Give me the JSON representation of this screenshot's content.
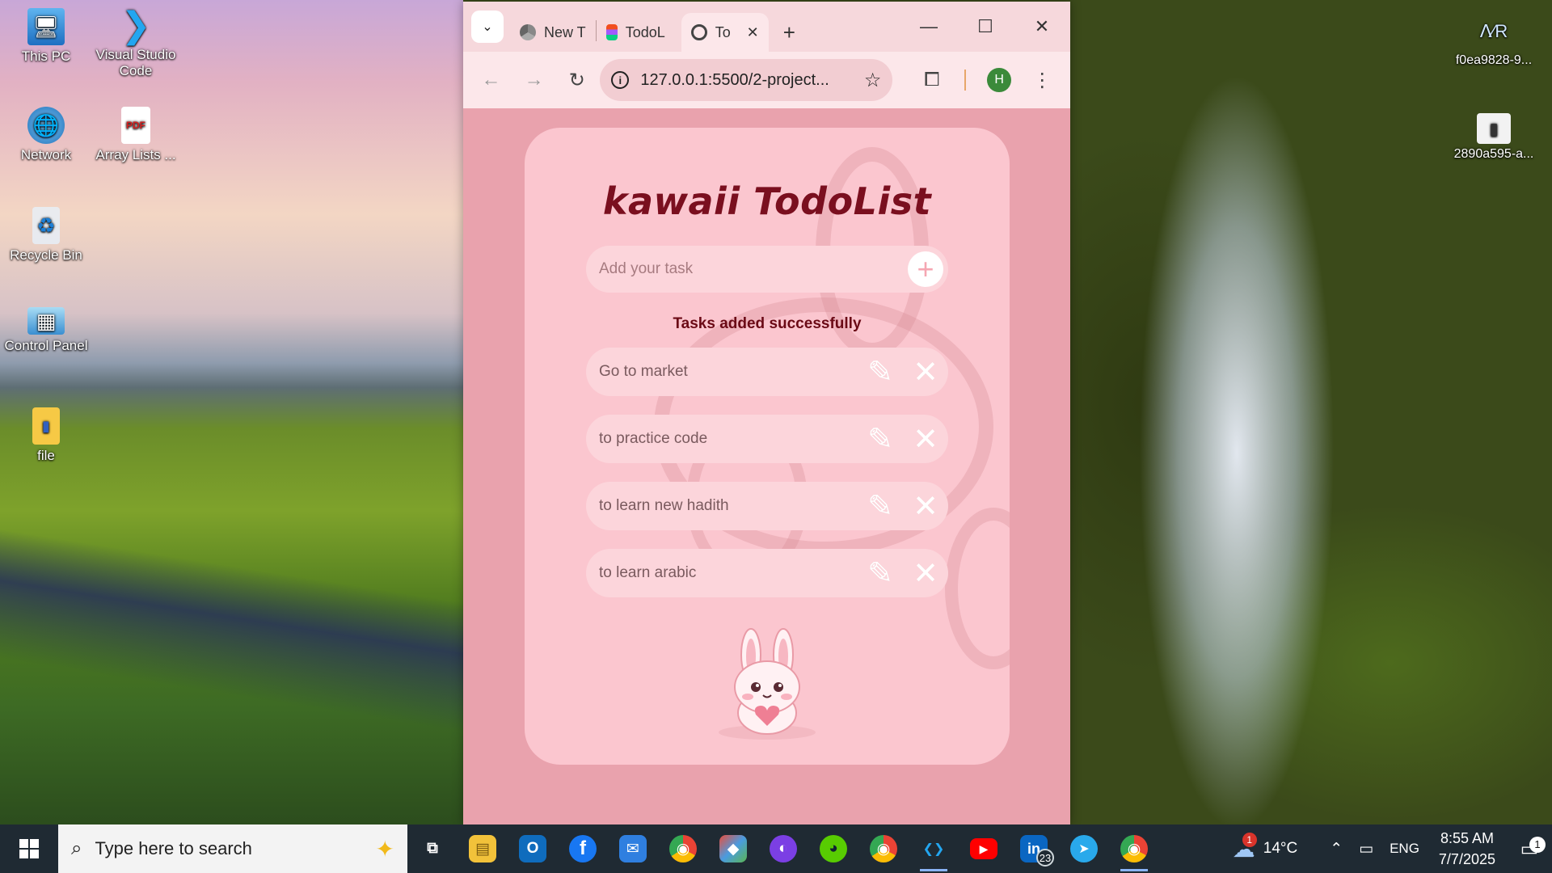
{
  "desktop": {
    "icons_left": [
      {
        "label": "This PC",
        "icon": "computer-icon"
      },
      {
        "label": "Visual Studio Code",
        "icon": "vscode-icon"
      },
      {
        "label": "Network",
        "icon": "network-icon"
      },
      {
        "label": "Array Lists ...",
        "icon": "pdf-icon"
      },
      {
        "label": "Recycle Bin",
        "icon": "recycle-bin-icon"
      },
      {
        "label": "Control Panel",
        "icon": "control-panel-icon"
      },
      {
        "label": "file",
        "icon": "file-icon"
      }
    ],
    "icons_right": [
      {
        "label": "f0ea9828-9...",
        "icon": "image-file-icon"
      },
      {
        "label": "2890a595-a...",
        "icon": "image-file-icon"
      }
    ]
  },
  "browser": {
    "tabs": [
      {
        "label": "New T",
        "icon": "chrome-icon",
        "active": false
      },
      {
        "label": "TodoL",
        "icon": "figma-icon",
        "active": false
      },
      {
        "label": "To",
        "icon": "globe-icon",
        "active": true
      }
    ],
    "new_tab": "+",
    "window_controls": {
      "minimize": "—",
      "maximize": "☐",
      "close": "✕"
    },
    "url": "127.0.0.1:5500/2-project...",
    "profile_initial": "H"
  },
  "app": {
    "title": "kawaii TodoList",
    "input_placeholder": "Add your task",
    "add_button": "+",
    "status": "Tasks added successfully",
    "tasks": [
      {
        "text": "Go to market"
      },
      {
        "text": "to practice code"
      },
      {
        "text": "to learn new hadith"
      },
      {
        "text": "to learn arabic"
      }
    ],
    "edit_icon": "✎",
    "delete_icon": "✕",
    "colors": {
      "card": "#fbc6cf",
      "page": "#e9a2ad",
      "title": "#7a0f1f"
    }
  },
  "taskbar": {
    "search_placeholder": "Type here to search",
    "apps": [
      {
        "icon": "task-view-icon",
        "glyph": "⧉"
      },
      {
        "icon": "file-explorer-icon",
        "glyph": "▤"
      },
      {
        "icon": "outlook-icon",
        "glyph": "O"
      },
      {
        "icon": "facebook-icon",
        "glyph": "f"
      },
      {
        "icon": "mail-icon",
        "glyph": "✉"
      },
      {
        "icon": "chrome-profile-icon",
        "glyph": "◉"
      },
      {
        "icon": "git-icon",
        "glyph": "◆"
      },
      {
        "icon": "github-icon",
        "glyph": "◐"
      },
      {
        "icon": "duolingo-icon",
        "glyph": "◕"
      },
      {
        "icon": "chrome-profile-icon",
        "glyph": "◉"
      },
      {
        "icon": "vscode-icon",
        "glyph": "❮❯"
      },
      {
        "icon": "youtube-icon",
        "glyph": "▶"
      },
      {
        "icon": "linkedin-icon",
        "glyph": "in",
        "badge": "23"
      },
      {
        "icon": "telegram-icon",
        "glyph": "➤"
      },
      {
        "icon": "chrome-icon",
        "glyph": "◉"
      }
    ],
    "weather": {
      "temp": "14°C",
      "badge": "1"
    },
    "language": "ENG",
    "time": "8:55 AM",
    "date": "7/7/2025",
    "notifications": "1"
  }
}
